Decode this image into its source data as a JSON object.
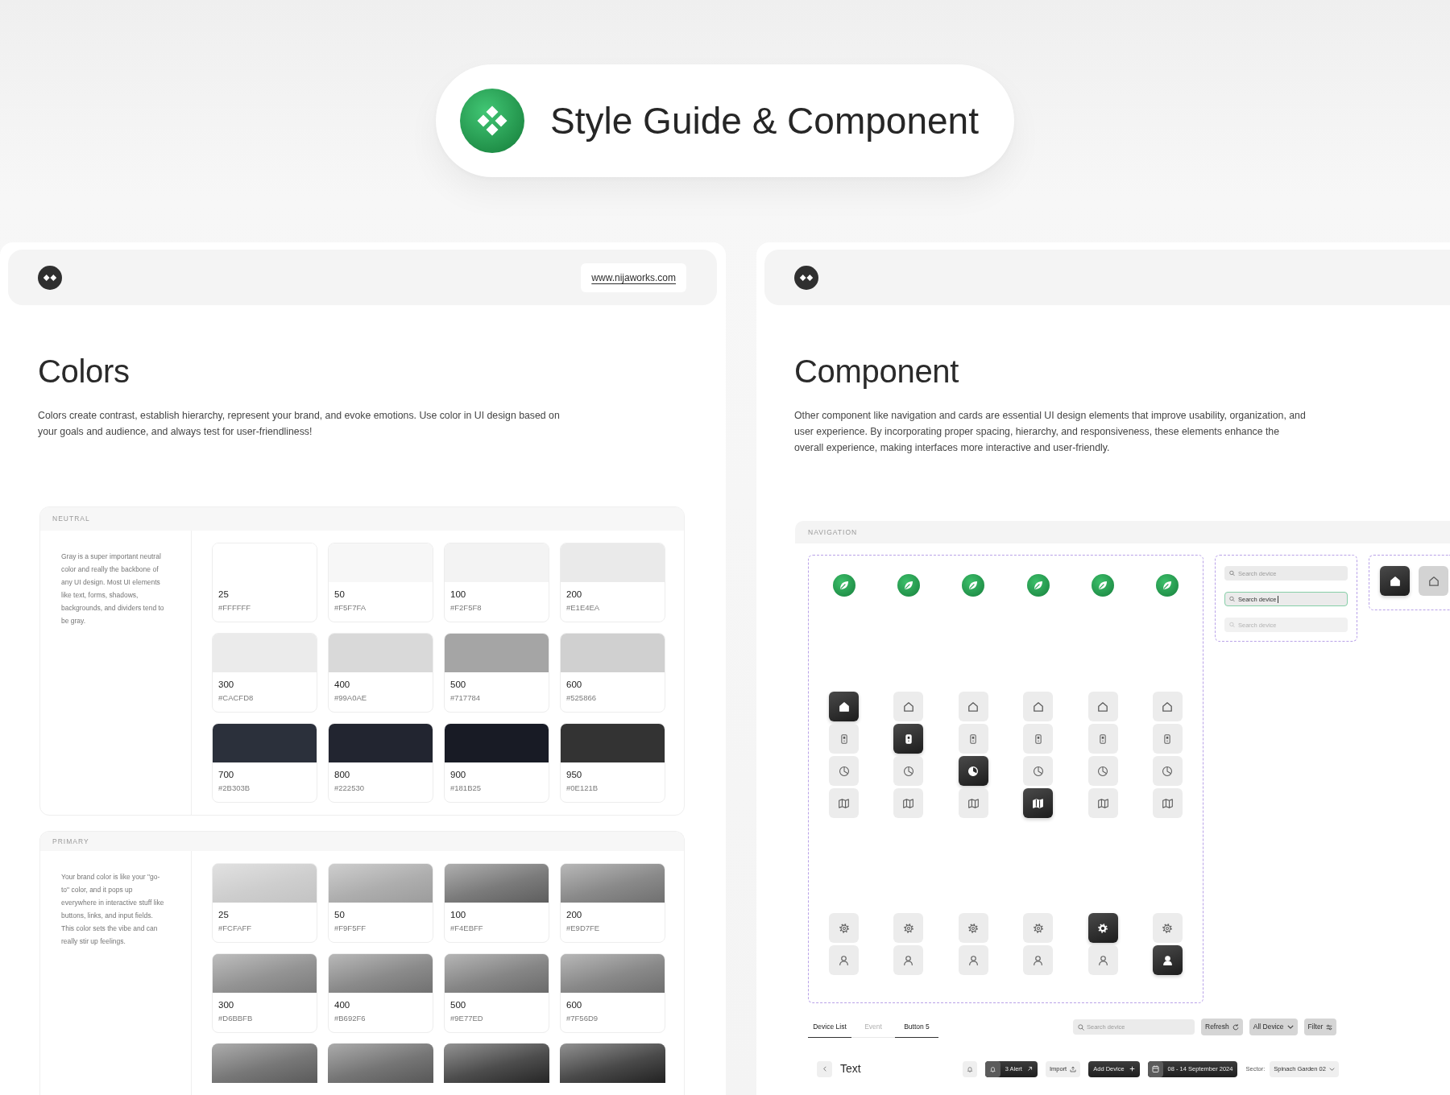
{
  "title_badge": {
    "title": "Style Guide & Component"
  },
  "colors_panel": {
    "header": {
      "link": "www.nijaworks.com"
    },
    "heading": "Colors",
    "description": "Colors create contrast, establish hierarchy, represent your brand, and evoke emotions. Use color in UI design based on your goals and audience, and always test for user-friendliness!",
    "palettes": [
      {
        "label": "NEUTRAL",
        "kind": "solid",
        "description": "Gray is a super important neutral color and really the backbone of any UI design. Most UI elements like text, forms, shadows, backgrounds, and dividers tend to be gray.",
        "swatches": [
          {
            "number": "25",
            "hex": "#FFFFFF",
            "color": "#ffffff"
          },
          {
            "number": "50",
            "hex": "#F5F7FA",
            "color": "#f7f7f7"
          },
          {
            "number": "100",
            "hex": "#F2F5F8",
            "color": "#f3f3f3"
          },
          {
            "number": "200",
            "hex": "#E1E4EA",
            "color": "#eaeaea"
          },
          {
            "number": "300",
            "hex": "#CACFD8",
            "color": "#ebebeb"
          },
          {
            "number": "400",
            "hex": "#99A0AE",
            "color": "#d9d9d9"
          },
          {
            "number": "500",
            "hex": "#717784",
            "color": "#a5a5a5"
          },
          {
            "number": "600",
            "hex": "#525866",
            "color": "#d0d0d0"
          },
          {
            "number": "700",
            "hex": "#2B303B",
            "color": "#2b303b"
          },
          {
            "number": "800",
            "hex": "#222530",
            "color": "#222530"
          },
          {
            "number": "900",
            "hex": "#181B25",
            "color": "#181b25"
          },
          {
            "number": "950",
            "hex": "#0E121B",
            "color": "#333333"
          }
        ]
      },
      {
        "label": "PRIMARY",
        "kind": "gradient",
        "description": "Your brand color is like your \"go-to\" color, and it pops up everywhere in interactive stuff like buttons, links, and input fields. This color sets the vibe and can really stir up feelings.",
        "swatches": [
          {
            "number": "25",
            "hex": "#FCFAFF",
            "color": "#c3c3c3"
          },
          {
            "number": "50",
            "hex": "#F9F5FF",
            "color": "#9c9c9c"
          },
          {
            "number": "100",
            "hex": "#F4EBFF",
            "color": "#5e5e5e"
          },
          {
            "number": "200",
            "hex": "#E9D7FE",
            "color": "#707070"
          },
          {
            "number": "300",
            "hex": "#D6BBFB",
            "color": "#7c7c7c"
          },
          {
            "number": "400",
            "hex": "#B692F6",
            "color": "#717171"
          },
          {
            "number": "500",
            "hex": "#9E77ED",
            "color": "#6b6b6b"
          },
          {
            "number": "600",
            "hex": "#7F56D9",
            "color": "#6f6f6f"
          },
          {
            "color": "#5a5a5a"
          },
          {
            "color": "#575757"
          },
          {
            "color": "#262626"
          },
          {
            "color": "#222222"
          }
        ]
      }
    ]
  },
  "component_panel": {
    "heading": "Component",
    "description": "Other component like navigation and cards are essential UI design elements that improve usability, organization, and user experience. By incorporating proper spacing, hierarchy, and responsiveness, these elements enhance the overall experience, making interfaces more interactive and user-friendly.",
    "navigation": {
      "label": "NAVIGATION",
      "rails": [
        {
          "top_items": [
            {
              "kind": "home",
              "selected": true
            },
            {
              "kind": "device",
              "selected": false
            },
            {
              "kind": "chart",
              "selected": false
            },
            {
              "kind": "map",
              "selected": false
            }
          ],
          "bottom_items": [
            {
              "kind": "settings",
              "selected": false
            },
            {
              "kind": "user",
              "selected": false
            }
          ]
        },
        {
          "top_items": [
            {
              "kind": "home",
              "selected": false
            },
            {
              "kind": "device",
              "selected": true
            },
            {
              "kind": "chart",
              "selected": false
            },
            {
              "kind": "map",
              "selected": false
            }
          ],
          "bottom_items": [
            {
              "kind": "settings",
              "selected": false
            },
            {
              "kind": "user",
              "selected": false
            }
          ]
        },
        {
          "top_items": [
            {
              "kind": "home",
              "selected": false
            },
            {
              "kind": "device",
              "selected": false
            },
            {
              "kind": "chart",
              "selected": true
            },
            {
              "kind": "map",
              "selected": false
            }
          ],
          "bottom_items": [
            {
              "kind": "settings",
              "selected": false
            },
            {
              "kind": "user",
              "selected": false
            }
          ]
        },
        {
          "top_items": [
            {
              "kind": "home",
              "selected": false
            },
            {
              "kind": "device",
              "selected": false
            },
            {
              "kind": "chart",
              "selected": false
            },
            {
              "kind": "map",
              "selected": true
            }
          ],
          "bottom_items": [
            {
              "kind": "settings",
              "selected": false
            },
            {
              "kind": "user",
              "selected": false
            }
          ]
        },
        {
          "top_items": [
            {
              "kind": "home",
              "selected": false
            },
            {
              "kind": "device",
              "selected": false
            },
            {
              "kind": "chart",
              "selected": false
            },
            {
              "kind": "map",
              "selected": false
            }
          ],
          "bottom_items": [
            {
              "kind": "settings",
              "selected": true
            },
            {
              "kind": "user",
              "selected": false
            }
          ]
        },
        {
          "top_items": [
            {
              "kind": "home",
              "selected": false
            },
            {
              "kind": "device",
              "selected": false
            },
            {
              "kind": "chart",
              "selected": false
            },
            {
              "kind": "map",
              "selected": false
            }
          ],
          "bottom_items": [
            {
              "kind": "settings",
              "selected": false
            },
            {
              "kind": "user",
              "selected": true
            }
          ]
        }
      ],
      "search_states": [
        {
          "placeholder": "Search device",
          "focused": false,
          "disabled": false
        },
        {
          "value": "Search device",
          "focused": true,
          "disabled": false
        },
        {
          "placeholder": "Search device",
          "focused": false,
          "disabled": true
        }
      ],
      "tile_states": [
        {
          "kind": "home",
          "selected": true,
          "hovered": false
        },
        {
          "kind": "home",
          "selected": false,
          "hovered": true
        }
      ],
      "tabs": [
        {
          "label": "Device List",
          "selected": true
        },
        {
          "label": "Event",
          "selected": false
        },
        {
          "label": "Button 5",
          "selected": true
        }
      ],
      "search": {
        "placeholder": "Search device"
      },
      "filter_buttons": [
        {
          "label": "Refresh",
          "kind": "refresh"
        },
        {
          "label": "All Device",
          "kind": "dropdown"
        },
        {
          "label": "Filter",
          "kind": "filter"
        }
      ],
      "page_header": {
        "title": "Text",
        "alert_label": "3 Alert",
        "import_label": "Import",
        "add_label": "Add Device",
        "date_range": "08 - 14 September 2024",
        "sector_label": "Sector:",
        "sector_value": "Spinach Garden 02"
      }
    }
  }
}
